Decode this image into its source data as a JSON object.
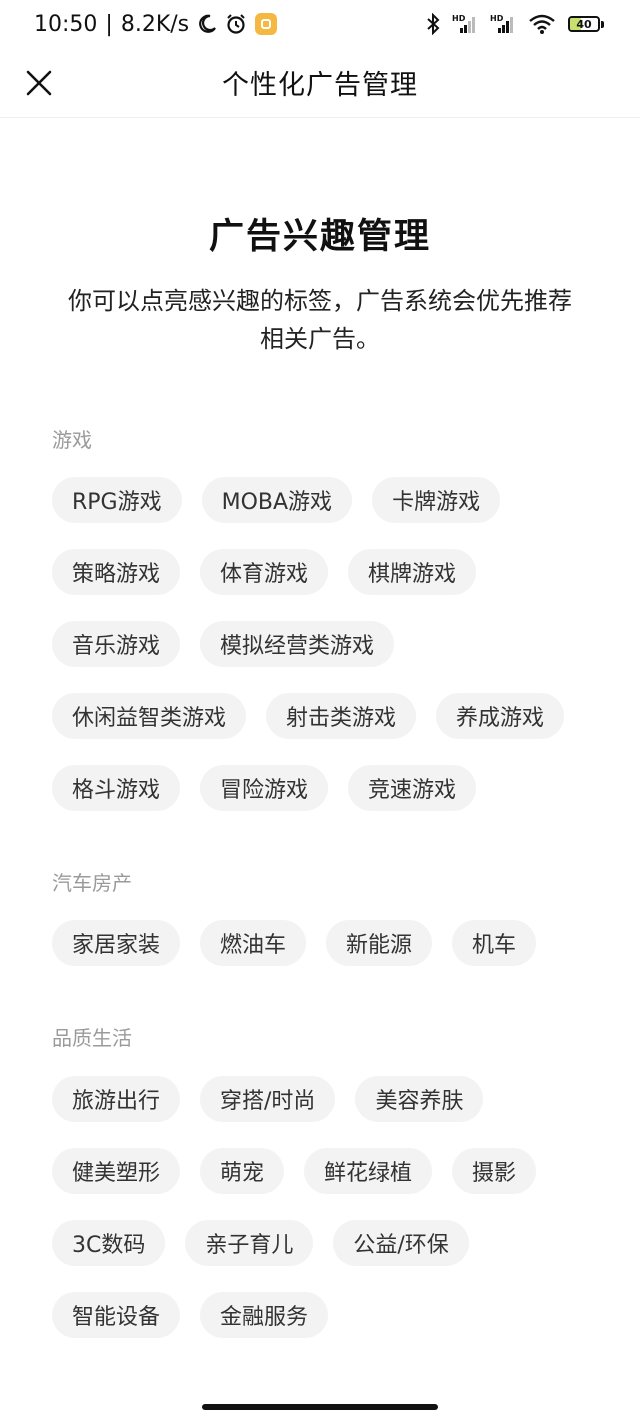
{
  "status_bar": {
    "time": "10:50",
    "separator": "|",
    "net_speed": "8.2K/s",
    "battery": "40",
    "battery_level": 0.4,
    "hd_label": "HD"
  },
  "header": {
    "title": "个性化广告管理"
  },
  "intro": {
    "heading": "广告兴趣管理",
    "description": "你可以点亮感兴趣的标签，广告系统会优先推荐相关广告。"
  },
  "sections": [
    {
      "label": "游戏",
      "rows": [
        [
          "RPG游戏",
          "MOBA游戏",
          "卡牌游戏"
        ],
        [
          "策略游戏",
          "体育游戏",
          "棋牌游戏"
        ],
        [
          "音乐游戏",
          "模拟经营类游戏"
        ],
        [
          "休闲益智类游戏",
          "射击类游戏",
          "养成游戏"
        ],
        [
          "格斗游戏",
          "冒险游戏",
          "竞速游戏"
        ]
      ]
    },
    {
      "label": "汽车房产",
      "rows": [
        [
          "家居家装",
          "燃油车",
          "新能源",
          "机车"
        ]
      ]
    },
    {
      "label": "品质生活",
      "rows": [
        [
          "旅游出行",
          "穿搭/时尚",
          "美容养肤"
        ],
        [
          "健美塑形",
          "萌宠",
          "鲜花绿植",
          "摄影"
        ],
        [
          "3C数码",
          "亲子育儿",
          "公益/环保"
        ],
        [
          "智能设备",
          "金融服务"
        ]
      ]
    }
  ],
  "colors": {
    "tag_bg": "#f3f3f3",
    "section_label": "#9a9a9a",
    "text": "#222222"
  }
}
